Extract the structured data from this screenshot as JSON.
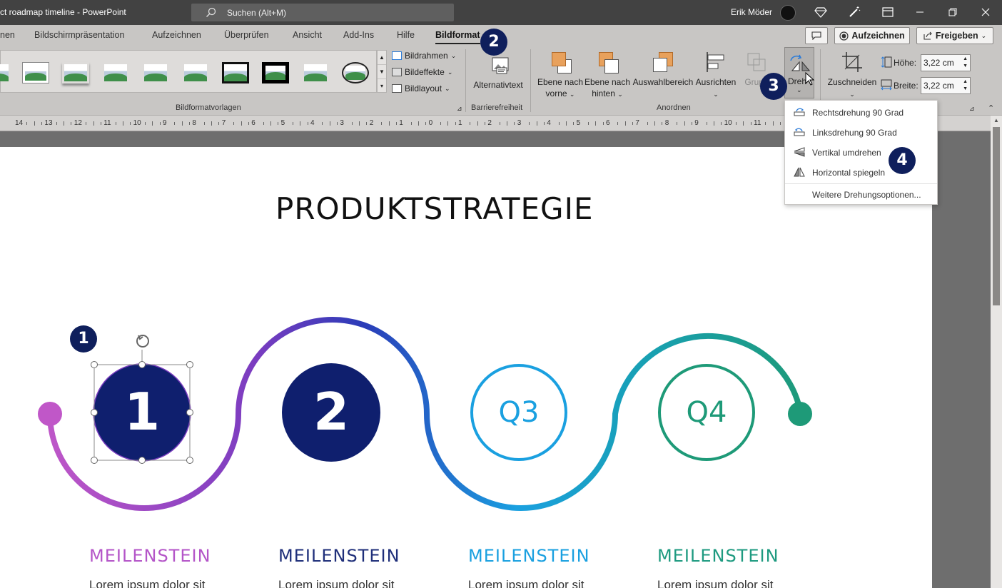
{
  "window": {
    "title": "ct roadmap timeline  -  PowerPoint",
    "search_placeholder": "Suchen (Alt+M)",
    "user_name": "Erik Möder"
  },
  "tabs": [
    {
      "label": "nen"
    },
    {
      "label": "Bildschirmpräsentation"
    },
    {
      "label": "Aufzeichnen"
    },
    {
      "label": "Überprüfen"
    },
    {
      "label": "Ansicht"
    },
    {
      "label": "Add-Ins"
    },
    {
      "label": "Hilfe"
    },
    {
      "label": "Bildformat"
    }
  ],
  "header_buttons": {
    "record_label": "Aufzeichnen",
    "share_label": "Freigeben"
  },
  "ribbon": {
    "picture_styles": {
      "border_label": "Bildrahmen",
      "effects_label": "Bildeffekte",
      "layout_label": "Bildlayout",
      "group_label": "Bildformatvorlagen"
    },
    "accessibility": {
      "alt_text_label": "Alternativtext",
      "group_label": "Barrierefreiheit"
    },
    "arrange": {
      "bring_forward_line1": "Ebene nach",
      "bring_forward_line2": "vorne",
      "send_backward_line1": "Ebene nach",
      "send_backward_line2": "hinten",
      "selection_pane_label": "Auswahlbereich",
      "align_label": "Ausrichten",
      "group_btn_label": "Grupp",
      "rotate_label": "Dreh",
      "group_label": "Anordnen"
    },
    "size": {
      "crop_label": "Zuschneiden",
      "height_label": "Höhe:",
      "height_value": "3,22 cm",
      "width_label": "Breite:",
      "width_value": "3,22 cm"
    }
  },
  "ruler": {
    "ticks": [
      "14",
      "13",
      "12",
      "11",
      "10",
      "9",
      "8",
      "7",
      "6",
      "5",
      "4",
      "3",
      "2",
      "1",
      "0",
      "1",
      "2",
      "3",
      "4",
      "5",
      "6",
      "7",
      "8",
      "9",
      "10",
      "11"
    ]
  },
  "rotate_menu": {
    "items": [
      {
        "label": "Rechtsdrehung 90 Grad",
        "icon": "rotate-right-icon"
      },
      {
        "label": "Linksdrehung 90 Grad",
        "icon": "rotate-left-icon"
      },
      {
        "label": "Vertikal umdrehen",
        "icon": "flip-vertical-icon"
      },
      {
        "label": "Horizontal spiegeln",
        "icon": "flip-horizontal-icon"
      }
    ],
    "more_options": "Weitere Drehungsoptionen..."
  },
  "slide": {
    "title": "PRODUKTSTRATEGIE",
    "milestones": [
      {
        "node": "1",
        "heading": "MEILENSTEIN",
        "text": "Lorem ipsum dolor sit",
        "color": "#b455c8"
      },
      {
        "node": "2",
        "heading": "MEILENSTEIN",
        "text": "Lorem ipsum dolor sit",
        "color": "#1f2f7a"
      },
      {
        "node": "Q3",
        "heading": "MEILENSTEIN",
        "text": "Lorem ipsum dolor sit",
        "color": "#1aa0e0"
      },
      {
        "node": "Q4",
        "heading": "MEILENSTEIN",
        "text": "Lorem ipsum dolor sit",
        "color": "#1e9a80"
      }
    ]
  },
  "annotations": {
    "badges": [
      "1",
      "2",
      "3",
      "4"
    ]
  },
  "colors": {
    "titlebar": "#424242",
    "ribbon": "#c8c6c4",
    "navy": "#0f1f6e",
    "badge": "#0f1f5c"
  }
}
